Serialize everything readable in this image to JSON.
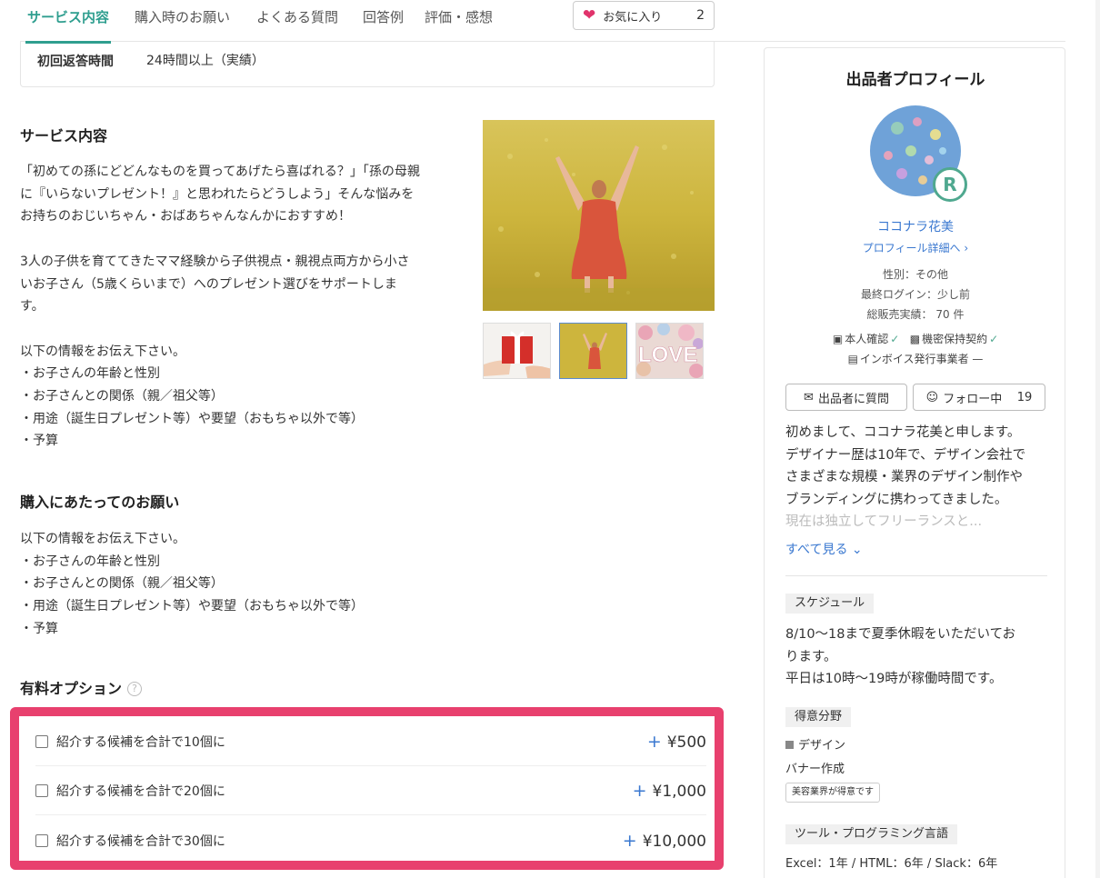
{
  "tabs": [
    {
      "label": "サービス内容",
      "active": true
    },
    {
      "label": "購入時のお願い"
    },
    {
      "label": "よくある質問"
    },
    {
      "label": "回答例"
    },
    {
      "label": "評価・感想"
    }
  ],
  "favorite": {
    "label": "お気に入り",
    "count": "2",
    "icon": "heart-icon",
    "color": "#e0336b"
  },
  "first_response": {
    "label": "初回返答時間",
    "value": "24時間以上（実績）"
  },
  "service": {
    "heading": "サービス内容",
    "lines": [
      "「初めての孫にどどんなものを買ってあげたら喜ばれる？」「孫の母親",
      "に『いらないプレゼント！』と思われたらどうしよう」そんな悩みを",
      "お持ちのおじいちゃん・おばあちゃんなんかにおすすめ！",
      "",
      "3人の子供を育ててきたママ経験から子供視点・親視点両方から小さ",
      "いお子さん（5歳くらいまで）へのプレゼント選びをサポートしま",
      "す。",
      "",
      "以下の情報をお伝え下さい。",
      "・お子さんの年齢と性別",
      "・お子さんとの関係（親／祖父等）",
      "・用途（誕生日プレゼント等）や要望（おもちゃ以外で等）",
      "・予算"
    ]
  },
  "gallery": {
    "thumbnail_count": 3,
    "selected_index": 1,
    "love_text": "LOVE"
  },
  "request": {
    "heading": "購入にあたってのお願い",
    "lines": [
      "以下の情報をお伝え下さい。",
      "・お子さんの年齢と性別",
      "・お子さんとの関係（親／祖父等）",
      "・用途（誕生日プレゼント等）や要望（おもちゃ以外で等）",
      "・予算"
    ]
  },
  "options": {
    "heading": "有料オプション",
    "help_icon": "?",
    "highlight_color": "#e8406e",
    "items": [
      {
        "label": "紹介する候補を合計で10個に",
        "price": "¥500"
      },
      {
        "label": "紹介する候補を合計で20個に",
        "price": "¥1,000"
      },
      {
        "label": "紹介する候補を合計で30個に",
        "price": "¥10,000"
      }
    ],
    "plus": "+"
  },
  "profile": {
    "title": "出品者プロフィール",
    "rank": "R",
    "name": "ココナラ花美",
    "detail_link": "プロフィール詳細へ",
    "gender": "性別：その他",
    "last_login": "最終ログイン：少し前",
    "sales": "総販売実績： 70 件",
    "badges": {
      "identity": "本人確認",
      "nda": "機密保持契約",
      "invoice": "インボイス発行事業者"
    },
    "question_button": "出品者に質問",
    "follow_button": "フォロー中",
    "follow_count": "19",
    "bio_lines": [
      "初めまして、ココナラ花美と申します。",
      "デザイナー歴は10年で、デザイン会社で",
      "さまざまな規模・業界のデザイン制作や",
      "ブランディングに携わってきました。"
    ],
    "bio_fade": "現在は独立してフリーランスと...",
    "see_all": "すべて見る",
    "schedule": {
      "tag": "スケジュール",
      "lines": [
        "8/10〜18まで夏季休暇をいただいてお",
        "ります。",
        "平日は10時〜19時が稼働時間です。"
      ]
    },
    "specialty": {
      "tag": "得意分野",
      "category": "デザイン",
      "item": "バナー作成",
      "chip": "美容業界が得意です"
    },
    "tools": {
      "tag": "ツール・プログラミング言語",
      "text": "Excel：1年 / HTML：6年 / Slack：6年"
    }
  },
  "accent": "#2f9e8f",
  "link_color": "#3a78d0"
}
